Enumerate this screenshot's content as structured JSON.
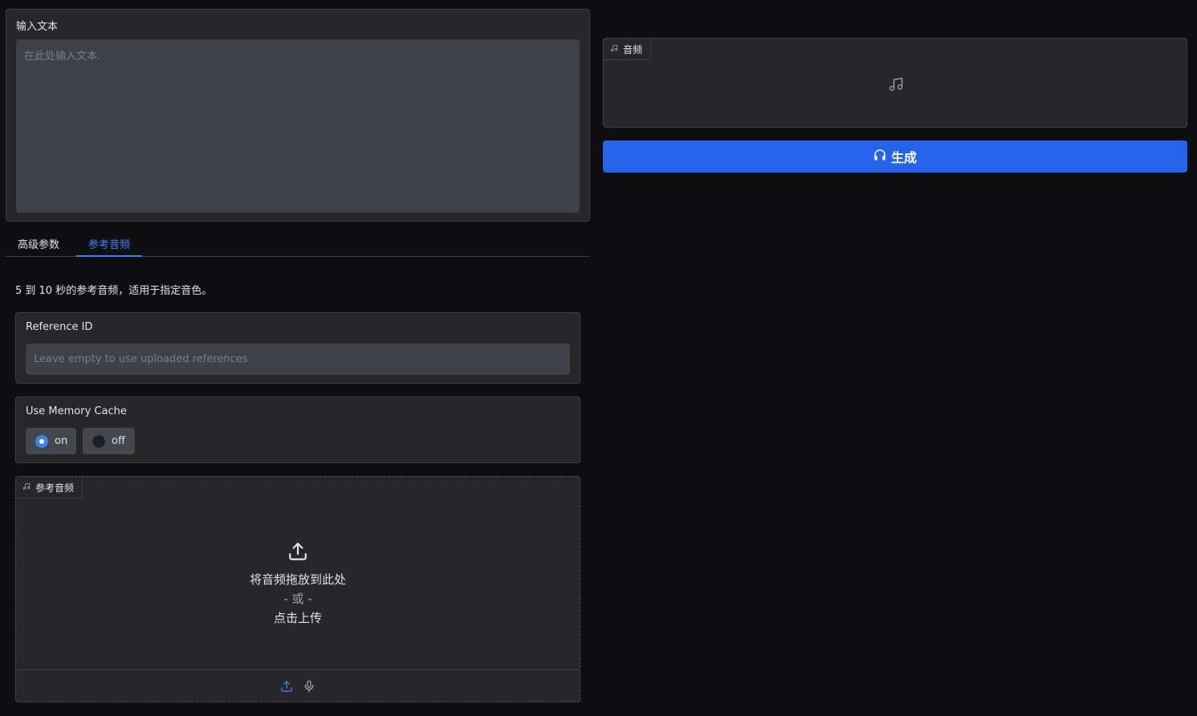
{
  "input_text": {
    "label": "输入文本",
    "placeholder": "在此处输入文本.",
    "value": ""
  },
  "tabs": [
    {
      "label": "高级参数",
      "active": false
    },
    {
      "label": "参考音频",
      "active": true
    }
  ],
  "reference_hint": "5 到 10 秒的参考音频，适用于指定音色。",
  "reference_id": {
    "label": "Reference ID",
    "placeholder": "Leave empty to use uploaded references",
    "value": ""
  },
  "memory_cache": {
    "label": "Use Memory Cache",
    "options": [
      {
        "label": "on",
        "checked": true
      },
      {
        "label": "off",
        "checked": false
      }
    ]
  },
  "reference_audio": {
    "badge_label": "参考音频",
    "badge_icon": "music-note-icon",
    "drop_text": "将音频拖放到此处",
    "or_text": "- 或 -",
    "click_text": "点击上传",
    "footer_icons": [
      "upload-icon",
      "microphone-icon"
    ]
  },
  "output_audio": {
    "badge_label": "音频",
    "badge_icon": "music-note-icon",
    "empty_icon": "music-note-icon"
  },
  "generate_button": {
    "label": "生成",
    "icon": "headphones-icon"
  },
  "colors": {
    "background": "#0f0f11",
    "panel": "#27272a",
    "input": "#3f4048",
    "accent": "#3b82f6",
    "button": "#2563eb"
  }
}
